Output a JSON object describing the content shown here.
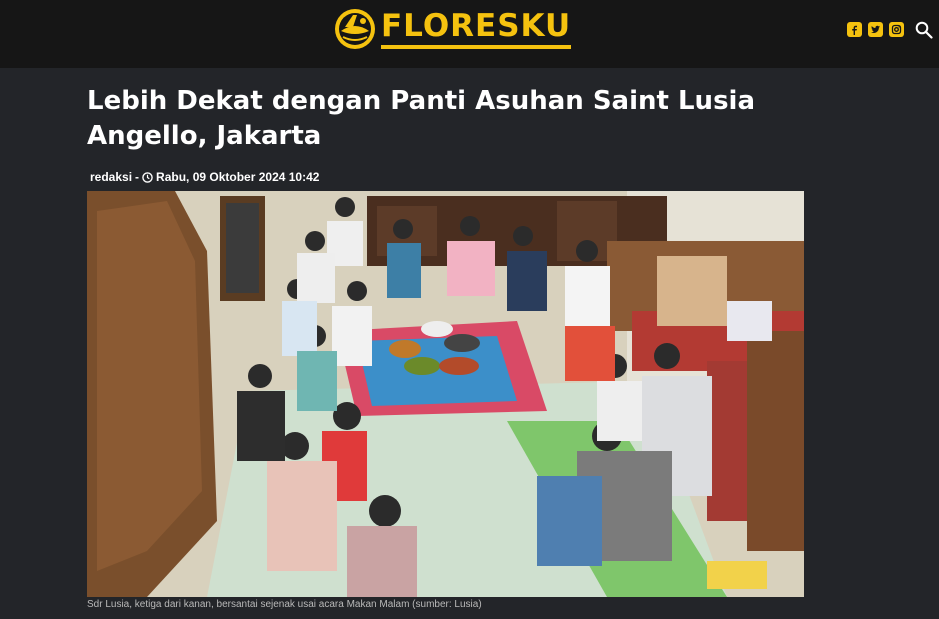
{
  "header": {
    "logo_text": "FLORESKU",
    "brand_color": "#f5c20f",
    "social_icons": [
      "facebook-icon",
      "twitter-icon",
      "instagram-icon"
    ],
    "search_icon": "search-icon"
  },
  "article": {
    "title": "Lebih Dekat dengan Panti Asuhan Saint Lusia Angello, Jakarta",
    "author": "redaksi",
    "separator": "-",
    "date": "Rabu, 09 Oktober 2024 10:42",
    "caption": "Sdr Lusia, ketiga dari kanan, bersantai sejenak usai acara Makan Malam (sumber: Lusia)"
  }
}
